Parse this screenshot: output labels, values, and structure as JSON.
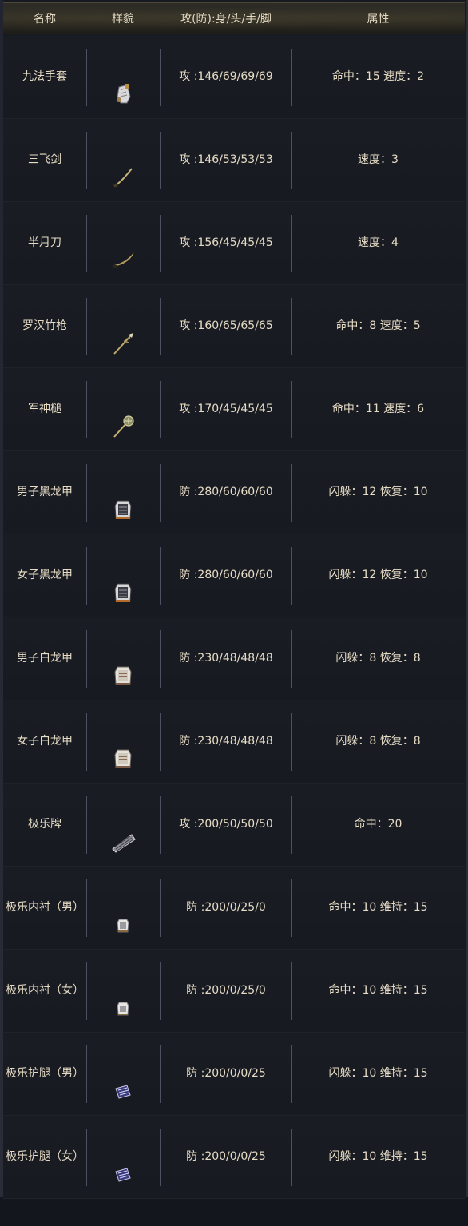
{
  "headers": {
    "name": "名称",
    "look": "样貌",
    "stats": "攻(防):身/头/手/脚",
    "attr": "属性"
  },
  "rows": [
    {
      "name": "九法手套",
      "icon": "glove-icon",
      "stats": "攻 :146/69/69/69",
      "attr": "命中：15 速度：2"
    },
    {
      "name": "三飞剑",
      "icon": "sword-icon",
      "stats": "攻 :146/53/53/53",
      "attr": "速度：3"
    },
    {
      "name": "半月刀",
      "icon": "blade-icon",
      "stats": "攻 :156/45/45/45",
      "attr": "速度：4"
    },
    {
      "name": "罗汉竹枪",
      "icon": "spear-icon",
      "stats": "攻 :160/65/65/65",
      "attr": "命中：8 速度：5"
    },
    {
      "name": "军神槌",
      "icon": "mace-icon",
      "stats": "攻 :170/45/45/45",
      "attr": "命中：11 速度：6"
    },
    {
      "name": "男子黑龙甲",
      "icon": "black-armor-icon",
      "stats": "防 :280/60/60/60",
      "attr": "闪躲：12 恢复：10"
    },
    {
      "name": "女子黑龙甲",
      "icon": "black-armor-icon",
      "stats": "防 :280/60/60/60",
      "attr": "闪躲：12 恢复：10"
    },
    {
      "name": "男子白龙甲",
      "icon": "white-armor-icon",
      "stats": "防 :230/48/48/48",
      "attr": "闪躲：8 恢复：8"
    },
    {
      "name": "女子白龙甲",
      "icon": "white-armor-icon",
      "stats": "防 :230/48/48/48",
      "attr": "闪躲：8 恢复：8"
    },
    {
      "name": "极乐牌",
      "icon": "plaque-icon",
      "stats": "攻 :200/50/50/50",
      "attr": "命中：20"
    },
    {
      "name": "极乐内衬（男）",
      "icon": "inner-shirt-icon",
      "stats": "防 :200/0/25/0",
      "attr": "命中：10 维持：15"
    },
    {
      "name": "极乐内衬（女）",
      "icon": "inner-shirt-icon",
      "stats": "防 :200/0/25/0",
      "attr": "命中：10 维持：15"
    },
    {
      "name": "极乐护腿（男）",
      "icon": "leg-guard-icon",
      "stats": "防 :200/0/0/25",
      "attr": "闪躲：10 维持：15"
    },
    {
      "name": "极乐护腿（女）",
      "icon": "leg-guard-icon",
      "stats": "防 :200/0/0/25",
      "attr": "闪躲：10 维持：15"
    }
  ]
}
